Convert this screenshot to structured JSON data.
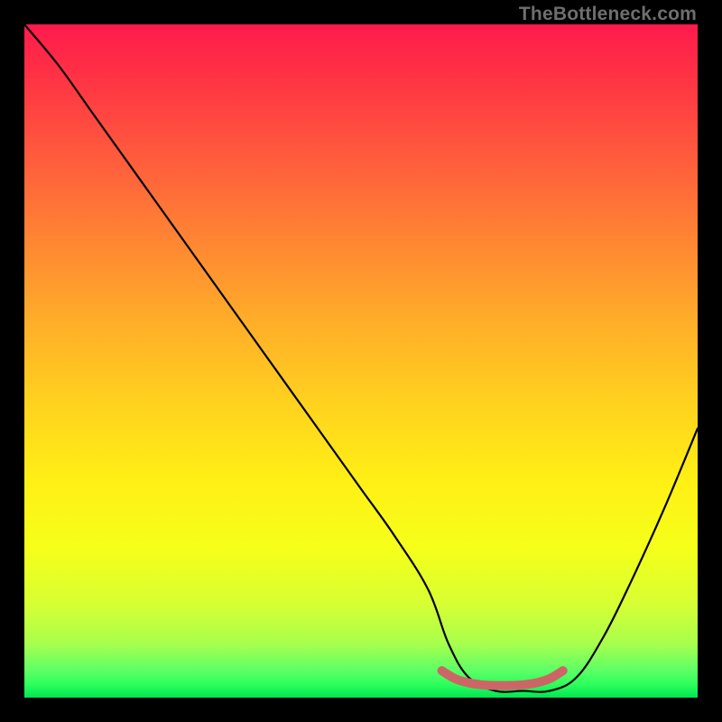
{
  "watermark": "TheBottleneck.com",
  "chart_data": {
    "type": "line",
    "title": "",
    "xlabel": "",
    "ylabel": "",
    "xlim": [
      0,
      100
    ],
    "ylim": [
      0,
      100
    ],
    "series": [
      {
        "name": "bottleneck-curve",
        "x": [
          0,
          5,
          10,
          15,
          20,
          25,
          30,
          35,
          40,
          45,
          50,
          55,
          60,
          63,
          66,
          70,
          74,
          78,
          82,
          86,
          90,
          95,
          100
        ],
        "y": [
          100,
          94,
          87,
          80,
          73,
          66,
          59,
          52,
          45,
          38,
          31,
          24,
          16,
          8,
          3,
          1,
          1,
          1,
          3,
          9,
          17,
          28,
          40
        ]
      },
      {
        "name": "optimal-marker",
        "x": [
          62,
          64,
          66,
          68,
          70,
          72,
          74,
          76,
          78,
          80
        ],
        "y": [
          4.0,
          2.8,
          2.2,
          1.9,
          1.8,
          1.8,
          1.9,
          2.2,
          2.8,
          4.0
        ]
      }
    ],
    "gradient_stops": [
      {
        "pos": 0,
        "color": "#ff1a4d"
      },
      {
        "pos": 50,
        "color": "#ffd11f"
      },
      {
        "pos": 100,
        "color": "#00e653"
      }
    ]
  }
}
